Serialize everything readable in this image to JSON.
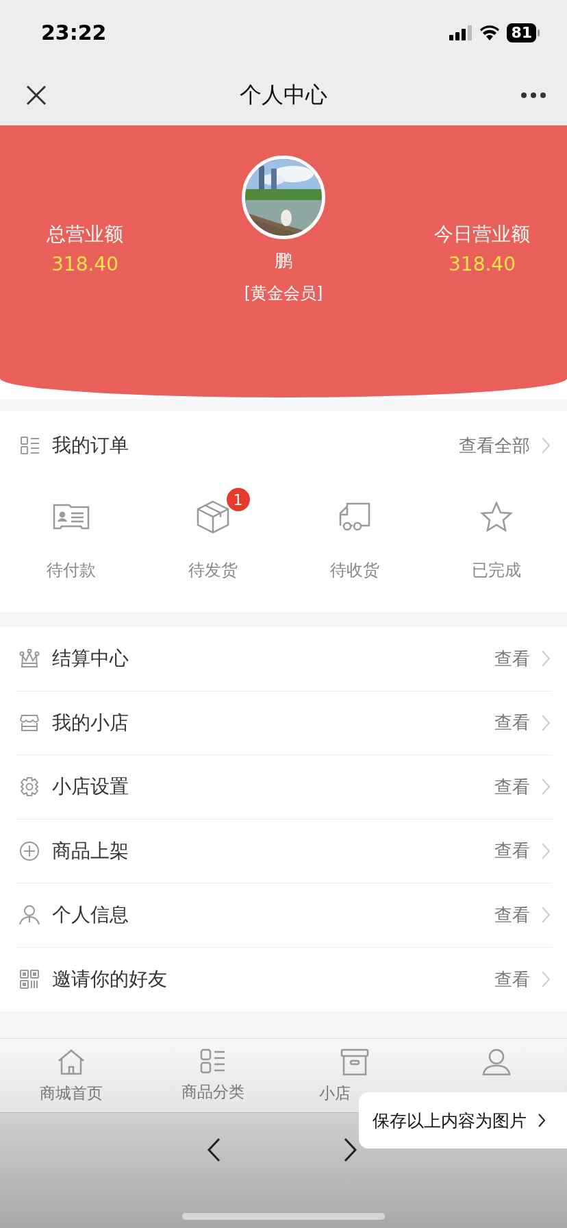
{
  "status_bar": {
    "time": "23:22",
    "battery": "81"
  },
  "nav_bar": {
    "title": "个人中心"
  },
  "profile": {
    "stats": [
      {
        "label": "总营业额",
        "value": "318.40"
      },
      {
        "label": "今日营业额",
        "value": "318.40"
      }
    ],
    "name": "鹏",
    "member_level": "[黄金会员]"
  },
  "orders": {
    "title": "我的订单",
    "view_all": "查看全部",
    "statuses": [
      {
        "label": "待付款"
      },
      {
        "label": "待发货",
        "badge": "1"
      },
      {
        "label": "待收货"
      },
      {
        "label": "已完成"
      }
    ]
  },
  "menu": [
    {
      "label": "结算中心",
      "action": "查看"
    },
    {
      "label": "我的小店",
      "action": "查看"
    },
    {
      "label": "小店设置",
      "action": "查看"
    },
    {
      "label": "商品上架",
      "action": "查看"
    },
    {
      "label": "个人信息",
      "action": "查看"
    },
    {
      "label": "邀请你的好友",
      "action": "查看"
    }
  ],
  "tab_bar": [
    {
      "label": "商城首页",
      "selected": false
    },
    {
      "label": "商品分类",
      "selected": false
    },
    {
      "label": "小店",
      "selected": false
    },
    {
      "selected": false
    }
  ],
  "save_popup": {
    "label": "保存以上内容为图片"
  }
}
